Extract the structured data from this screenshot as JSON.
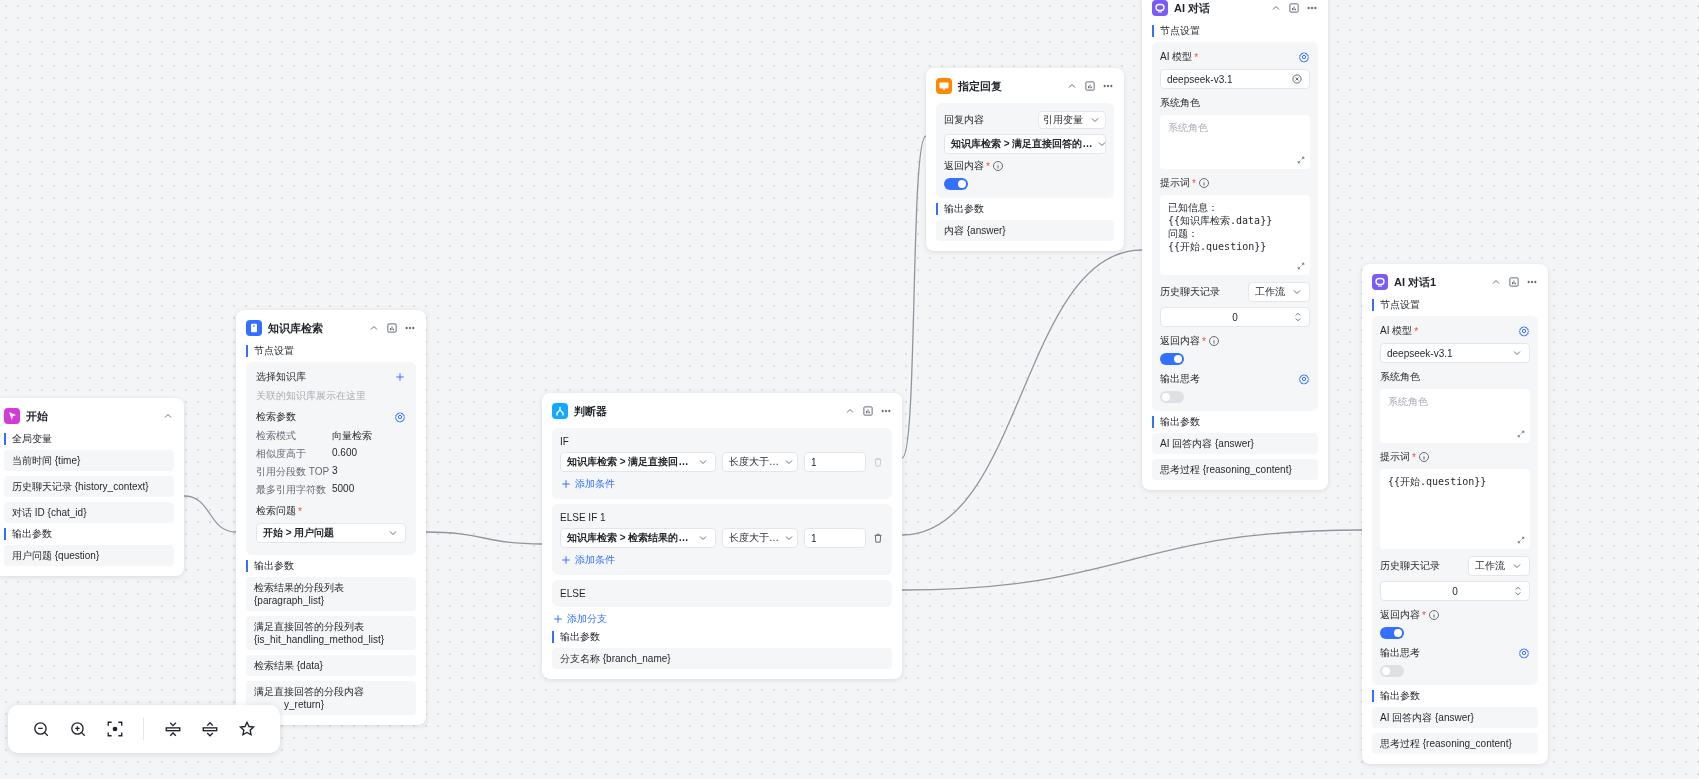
{
  "start": {
    "title": "开始",
    "sections": [
      {
        "heading": "全局变量",
        "items": [
          "当前时间 {time}",
          "历史聊天记录 {history_context}",
          "对话 ID {chat_id}"
        ]
      },
      {
        "heading": "输出参数",
        "items": [
          "用户问题 {question}"
        ]
      }
    ]
  },
  "knowledge": {
    "title": "知识库检索",
    "section": "节点设置",
    "kb_label": "选择知识库",
    "kb_placeholder": "关联的知识库展示在这里",
    "params_label": "检索参数",
    "params": [
      {
        "label": "检索模式",
        "value": "向量检索"
      },
      {
        "label": "相似度高于",
        "value": "0.600"
      },
      {
        "label": "引用分段数 TOP",
        "value": "3"
      },
      {
        "label": "最多引用字符数",
        "value": "5000"
      }
    ],
    "question_label": "检索问题",
    "question_mark": "*",
    "question_value": "开始 > 用户问题",
    "output_heading": "输出参数",
    "outputs": [
      {
        "lines": [
          "检索结果的分段列表",
          "{paragraph_list}"
        ]
      },
      {
        "lines": [
          "满足直接回答的分段列表",
          "{is_hit_handling_method_list}"
        ]
      },
      {
        "lines": [
          "检索结果 {data}"
        ]
      },
      {
        "lines": [
          "满足直接回答的分段内容"
        ],
        "cut_line": "y_return}"
      }
    ]
  },
  "condition": {
    "title": "判断器",
    "branches": [
      {
        "label": "IF",
        "conditions": [
          {
            "field": "知识库检索 > 满足直接回…",
            "op": "长度大于…",
            "value": "1",
            "disabled": true
          }
        ],
        "add": "添加条件"
      },
      {
        "label": "ELSE IF 1",
        "conditions": [
          {
            "field": "知识库检索 > 检索结果的…",
            "op": "长度大于…",
            "value": "1",
            "disabled": false
          }
        ],
        "add": "添加条件"
      }
    ],
    "else_label": "ELSE",
    "add_branch": "添加分支",
    "output_heading": "输出参数",
    "outputs": [
      "分支名称 {branch_name}"
    ]
  },
  "reply": {
    "title": "指定回复",
    "content_label": "回复内容",
    "mode": "引用变量",
    "value": "知识库检索 > 满足直接回答的…",
    "return_label": "返回内容",
    "return_mark": "*",
    "return_on": true,
    "output_heading": "输出参数",
    "outputs": [
      "内容 {answer}"
    ]
  },
  "ai_nodes": [
    {
      "title": "AI 对话",
      "section": "节点设置",
      "model_label": "AI 模型",
      "model_mark": "*",
      "clearable": true,
      "model_value": "deepseek-v3.1",
      "role_label": "系统角色",
      "role_placeholder": "系统角色",
      "prompt_label": "提示词",
      "prompt_mark": "*",
      "prompt": "已知信息：\n{{知识库检索.data}}\n问题：\n{{开始.question}}",
      "history_label": "历史聊天记录",
      "history_mode": "工作流",
      "history_count": "0",
      "return_label": "返回内容",
      "return_mark": "*",
      "return_on": true,
      "thinking_label": "输出思考",
      "thinking_on": false,
      "output_heading": "输出参数",
      "outputs": [
        "AI 回答内容 {answer}",
        "思考过程 {reasoning_content}"
      ]
    },
    {
      "title": "AI 对话1",
      "section": "节点设置",
      "model_label": "AI 模型",
      "model_mark": "*",
      "clearable": false,
      "model_value": "deepseek-v3.1",
      "role_label": "系统角色",
      "role_placeholder": "系统角色",
      "prompt_label": "提示词",
      "prompt_mark": "*",
      "prompt": "{{开始.question}}",
      "history_label": "历史聊天记录",
      "history_mode": "工作流",
      "history_count": "0",
      "return_label": "返回内容",
      "return_mark": "*",
      "return_on": true,
      "thinking_label": "输出思考",
      "thinking_on": false,
      "output_heading": "输出参数",
      "outputs": [
        "AI 回答内容 {answer}",
        "思考过程 {reasoning_content}"
      ]
    }
  ]
}
